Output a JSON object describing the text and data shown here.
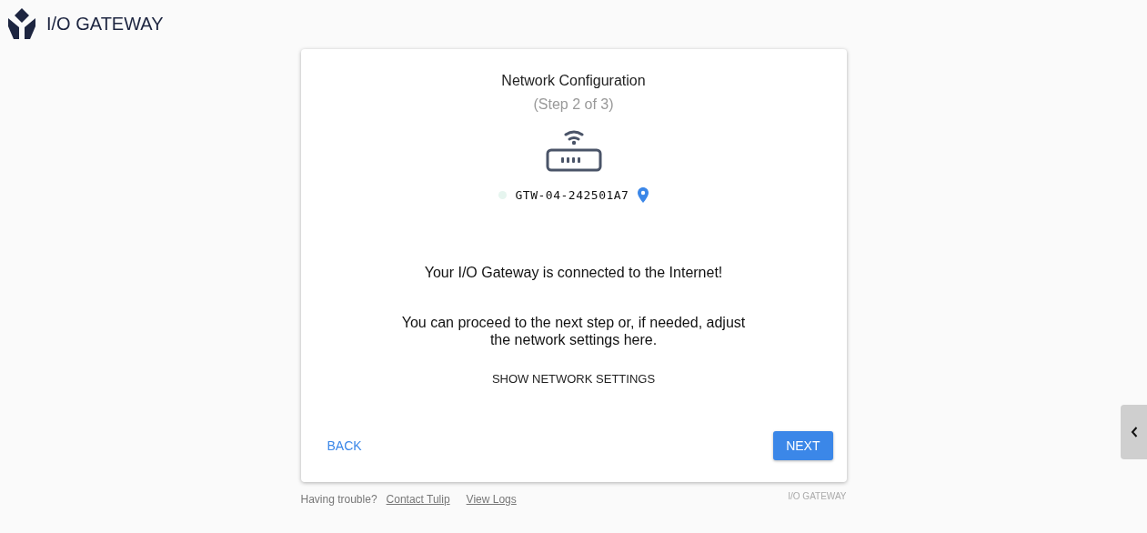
{
  "header": {
    "title": "I/O GATEWAY"
  },
  "card": {
    "title": "Network Configuration",
    "step": "(Step 2 of 3)",
    "device": {
      "name": "GTW-04-242501A7",
      "color": "#e6f5ef"
    },
    "message": "Your I/O Gateway is connected to the Internet!",
    "hint": "You can proceed to the next step or, if needed, adjust the network settings here.",
    "settings_link": "SHOW NETWORK SETTINGS",
    "back_button": "BACK",
    "next_button": "NEXT"
  },
  "footer": {
    "prompt": "Having trouble?",
    "links": [
      "Contact Tulip",
      "View Logs"
    ],
    "brand": "I/O GATEWAY"
  }
}
